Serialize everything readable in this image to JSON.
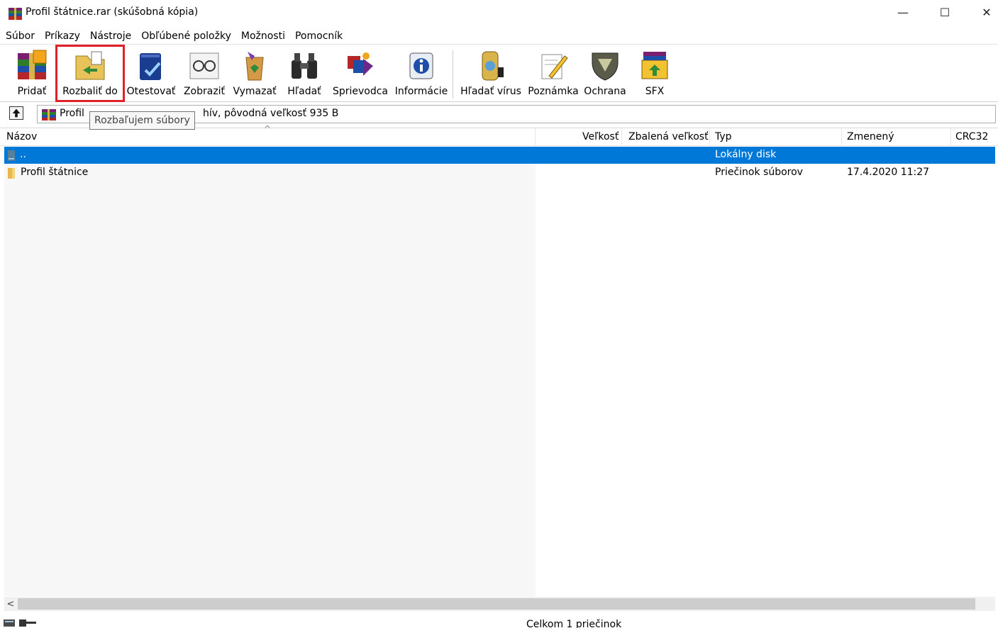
{
  "window": {
    "title": "Profil štátnice.rar (skúšobná kópia)",
    "minimize": "—",
    "maximize": "☐",
    "close": "✕"
  },
  "menu": [
    "Súbor",
    "Príkazy",
    "Nástroje",
    "Obľúbené položky",
    "Možnosti",
    "Pomocník"
  ],
  "toolbar": {
    "add": "Pridať",
    "extract_to": "Rozbaliť do",
    "test": "Otestovať",
    "view": "Zobraziť",
    "delete": "Vymazať",
    "find": "Hľadať",
    "wizard": "Sprievodca",
    "info": "Informácie",
    "virus_scan": "Hľadať vírus",
    "comment": "Poznámka",
    "protect": "Ochrana",
    "sfx": "SFX",
    "highlighted_button": "Rozbaliť do"
  },
  "address": {
    "text_before": "Profil ",
    "text_after": "hív, pôvodná veľkosť 935 B"
  },
  "tooltip": "Rozbaľujem súbory",
  "columns": {
    "name": "Názov",
    "size": "Veľkosť",
    "packed": "Zbalená veľkosť",
    "type": "Typ",
    "modified": "Zmenený",
    "crc": "CRC32"
  },
  "rows": [
    {
      "name": "..",
      "size": "",
      "packed": "",
      "type": "Lokálny disk",
      "modified": "",
      "crc": "",
      "selected": true
    },
    {
      "name": "Profil štátnice",
      "size": "",
      "packed": "",
      "type": "Priečinok súborov",
      "modified": "17.4.2020 11:27",
      "crc": "",
      "selected": false
    }
  ],
  "status": {
    "summary": "Celkom 1 priečinok"
  },
  "colors": {
    "selection": "#0078d7",
    "highlight_outline": "#e0212a"
  },
  "icons": {
    "app": "winrar-books-icon",
    "up": "up-folder-icon",
    "folder": "folder-icon",
    "drive": "drive-icon"
  }
}
